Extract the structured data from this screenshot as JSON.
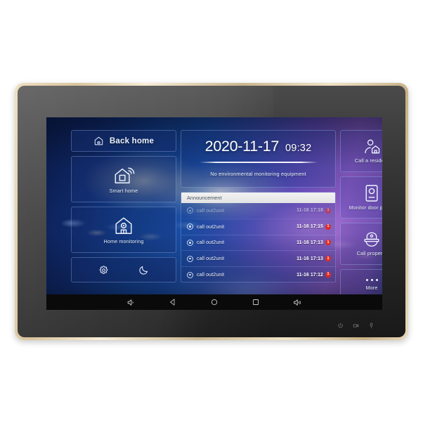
{
  "device": {
    "frame_color": "#dcc79f",
    "bezel_color": "#2b2b2b",
    "indicators": [
      {
        "name": "power-indicator-icon",
        "label": "power"
      },
      {
        "name": "talk-indicator-icon",
        "label": "talk"
      },
      {
        "name": "mic-indicator-icon",
        "label": "microphone"
      }
    ]
  },
  "screen": {
    "wallpaper_colors": {
      "left": "#0c1f52",
      "mid": "#1b4fa8",
      "right": "#8a5cc4"
    },
    "left_column": {
      "back_home": {
        "label": "Back home",
        "icon": "home-outline-icon"
      },
      "cards": [
        {
          "label": "Smart home",
          "icon": "smart-home-wifi-icon"
        },
        {
          "label": "Home monitoring",
          "icon": "home-camera-icon"
        }
      ],
      "quick_actions": [
        {
          "name": "settings",
          "icon": "gear-icon"
        },
        {
          "name": "do-not-disturb",
          "icon": "moon-icon"
        }
      ]
    },
    "datetime": {
      "date": "2020-11-17",
      "time": "09:32",
      "environment_status": "No environmental monitoring equipment"
    },
    "announcement": {
      "header": "Announcement",
      "rows": [
        {
          "title": "call out2unit",
          "time": "11-16 17:18",
          "badge": "1"
        },
        {
          "title": "call out2unit",
          "time": "11-16 17:15",
          "badge": "1"
        },
        {
          "title": "call out2unit",
          "time": "11-16 17:13",
          "badge": "1"
        },
        {
          "title": "call out2unit",
          "time": "11-16 17:13",
          "badge": "1"
        },
        {
          "title": "call out2unit",
          "time": "11-16 17:12",
          "badge": "1"
        }
      ],
      "badge_color": "#e02b20"
    },
    "right_column": [
      {
        "label": "Call a resident",
        "icon": "person-house-icon"
      },
      {
        "label": "Monitor door phone",
        "icon": "door-station-icon"
      },
      {
        "label": "Call property",
        "icon": "police-cap-icon"
      },
      {
        "label": "More",
        "icon": "ellipsis-icon"
      }
    ],
    "navbar": [
      {
        "name": "volume-down",
        "icon": "volume-down-icon"
      },
      {
        "name": "back",
        "icon": "back-triangle-icon"
      },
      {
        "name": "home",
        "icon": "home-circle-icon"
      },
      {
        "name": "recents",
        "icon": "recents-square-icon"
      },
      {
        "name": "volume-up",
        "icon": "volume-up-icon"
      }
    ]
  }
}
